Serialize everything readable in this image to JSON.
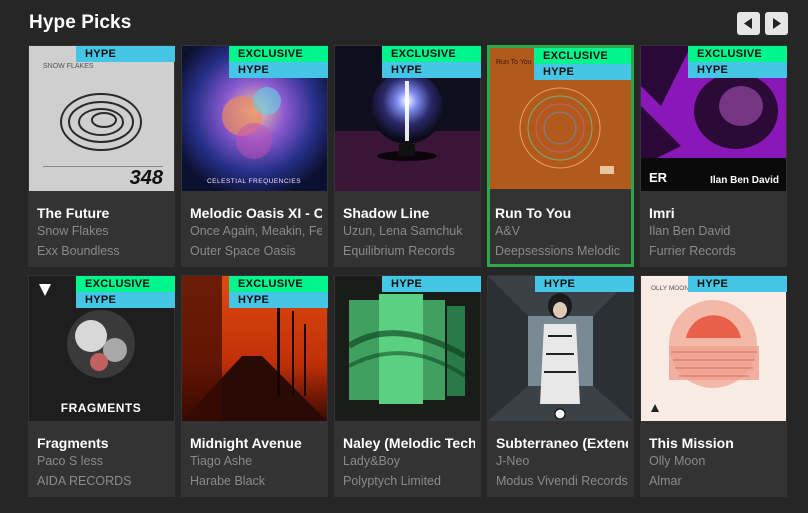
{
  "section": {
    "title": "Hype Picks",
    "prev_icon": "triangle-left-icon",
    "next_icon": "triangle-right-icon"
  },
  "colors": {
    "background": "#262626",
    "card": "#333333",
    "exclusive_badge": "#00f58c",
    "hype_badge": "#46c6e6",
    "selected_outline": "#2aa84a"
  },
  "tracks": [
    {
      "name": "The Future",
      "artist": "Snow Flakes",
      "label": "Exx Boundless",
      "exclusive": false,
      "hype": true,
      "cover_text": "348"
    },
    {
      "name": "Melodic Oasis XI - C",
      "artist": "Once Again, Meakin, Fer",
      "label": "Outer Space Oasis",
      "exclusive": true,
      "hype": true,
      "cover_text": "CELESTIAL FREQUENCIES"
    },
    {
      "name": "Shadow Line",
      "artist": "Uzun, Lena Samchuk",
      "label": "Equilibrium Records",
      "exclusive": true,
      "hype": true,
      "cover_text": ""
    },
    {
      "name": "Run To You",
      "artist": "A&V",
      "label": "Deepsessions Melodic",
      "exclusive": true,
      "hype": true,
      "cover_text": "Run To You",
      "selected": true
    },
    {
      "name": "Imri",
      "artist": "Ilan Ben David",
      "label": "Furrier Records",
      "exclusive": true,
      "hype": true,
      "cover_text": "Ilan Ben David"
    },
    {
      "name": "Fragments",
      "artist": "Paco S less",
      "label": "AIDA RECORDS",
      "exclusive": true,
      "hype": true,
      "cover_text": "FRAGMENTS"
    },
    {
      "name": "Midnight Avenue",
      "artist": "Tiago Ashe",
      "label": "Harabe Black",
      "exclusive": true,
      "hype": true,
      "cover_text": ""
    },
    {
      "name": "Naley (Melodic Techi",
      "artist": "Lady&Boy",
      "label": "Polyptych Limited",
      "exclusive": false,
      "hype": true,
      "cover_text": ""
    },
    {
      "name": "Subterraneo (Extend",
      "artist": "J-Neo",
      "label": "Modus Vivendi Records",
      "exclusive": false,
      "hype": true,
      "cover_text": ""
    },
    {
      "name": "This Mission",
      "artist": "Olly Moon",
      "label": "Almar",
      "exclusive": false,
      "hype": true,
      "cover_text": "OLLY MOON"
    }
  ],
  "badges": {
    "exclusive": "EXCLUSIVE",
    "hype": "HYPE"
  }
}
